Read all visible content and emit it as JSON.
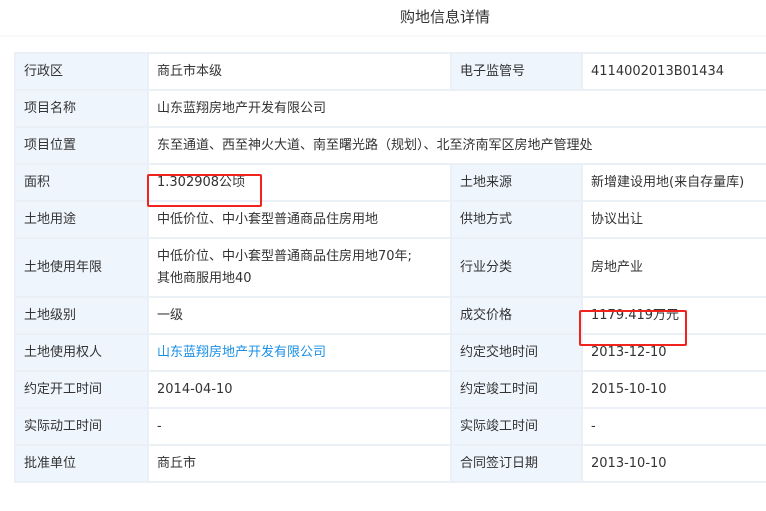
{
  "page_title": "购地信息详情",
  "rows": [
    {
      "label1": "行政区",
      "value1": "商丘市本级",
      "label2": "电子监管号",
      "value2": "4114002013B01434"
    },
    {
      "label1": "项目名称",
      "value1": "山东蓝翔房地产开发有限公司"
    },
    {
      "label1": "项目位置",
      "value1": "东至通道、西至神火大道、南至曙光路（规划）、北至济南军区房地产管理处"
    },
    {
      "label1": "面积",
      "value1": "1.302908公顷",
      "label2": "土地来源",
      "value2": "新增建设用地(来自存量库)"
    },
    {
      "label1": "土地用途",
      "value1": "中低价位、中小套型普通商品住房用地",
      "label2": "供地方式",
      "value2": "协议出让"
    },
    {
      "label1": "土地使用年限",
      "value1": "中低价位、中小套型普通商品住房用地70年;",
      "value1b": "其他商服用地40",
      "label2": "行业分类",
      "value2": "房地产业"
    },
    {
      "label1": "土地级别",
      "value1": "一级",
      "label2": "成交价格",
      "value2": "1179.419万元"
    },
    {
      "label1": "土地使用权人",
      "value1": "山东蓝翔房地产开发有限公司",
      "label2": "约定交地时间",
      "value2": "2013-12-10"
    },
    {
      "label1": "约定开工时间",
      "value1": "2014-04-10",
      "label2": "约定竣工时间",
      "value2": "2015-10-10"
    },
    {
      "label1": "实际动工时间",
      "value1": "-",
      "label2": "实际竣工时间",
      "value2": "-"
    },
    {
      "label1": "批准单位",
      "value1": "商丘市",
      "label2": "合同签订日期",
      "value2": "2013-10-10"
    }
  ],
  "colors": {
    "label_bg": "#eff5fc",
    "link": "#1a8fe6",
    "highlight": "#f0231e"
  }
}
